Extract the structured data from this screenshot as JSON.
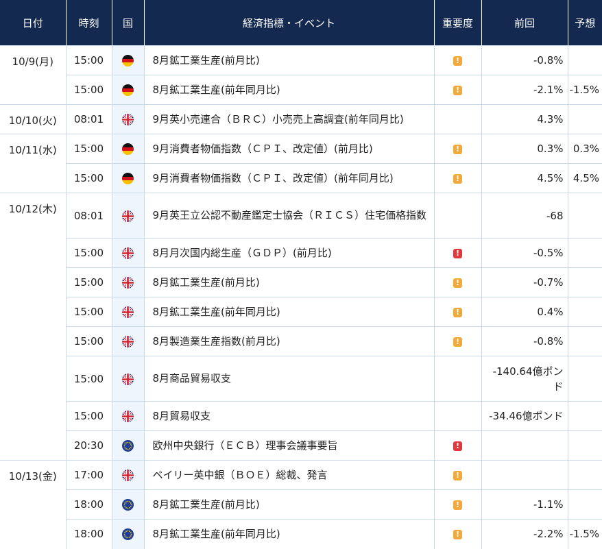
{
  "header": {
    "date": "日付",
    "time": "時刻",
    "country": "国",
    "event": "経済指標・イベント",
    "importance": "重要度",
    "previous": "前回",
    "forecast": "予想"
  },
  "importance_colors": {
    "mid": "#f2a93b",
    "high": "#e0383e"
  },
  "rows": [
    {
      "date": "10/9(月)",
      "time": "15:00",
      "country": "germany-flag-icon",
      "event": "8月鉱工業生産(前月比)",
      "importance": "mid",
      "importance_glyph": "!",
      "previous": "-0.8%",
      "forecast": ""
    },
    {
      "date": "",
      "time": "15:00",
      "country": "germany-flag-icon",
      "event": "8月鉱工業生産(前年同月比)",
      "importance": "mid",
      "importance_glyph": "!",
      "previous": "-2.1%",
      "forecast": "-1.5%"
    },
    {
      "date": "10/10(火)",
      "time": "08:01",
      "country": "uk-flag-icon",
      "event": "9月英小売連合（ＢＲＣ）小売売上高調査(前年同月比)",
      "importance": "",
      "importance_glyph": "",
      "previous": "4.3%",
      "forecast": ""
    },
    {
      "date": "10/11(水)",
      "time": "15:00",
      "country": "germany-flag-icon",
      "event": "9月消費者物価指数（ＣＰＩ、改定値）(前月比)",
      "importance": "mid",
      "importance_glyph": "!",
      "previous": "0.3%",
      "forecast": "0.3%"
    },
    {
      "date": "",
      "time": "15:00",
      "country": "germany-flag-icon",
      "event": "9月消費者物価指数（ＣＰＩ、改定値）(前年同月比)",
      "importance": "mid",
      "importance_glyph": "!",
      "previous": "4.5%",
      "forecast": "4.5%"
    },
    {
      "date": "10/12(木)",
      "time": "08:01",
      "country": "uk-flag-icon",
      "event": "9月英王立公認不動産鑑定士協会（ＲＩＣＳ）住宅価格指数",
      "importance": "",
      "importance_glyph": "",
      "previous": "-68",
      "forecast": ""
    },
    {
      "date": "",
      "time": "15:00",
      "country": "uk-flag-icon",
      "event": "8月月次国内総生産（ＧＤＰ）(前月比)",
      "importance": "high",
      "importance_glyph": "!",
      "previous": "-0.5%",
      "forecast": ""
    },
    {
      "date": "",
      "time": "15:00",
      "country": "uk-flag-icon",
      "event": "8月鉱工業生産(前月比)",
      "importance": "mid",
      "importance_glyph": "!",
      "previous": "-0.7%",
      "forecast": ""
    },
    {
      "date": "",
      "time": "15:00",
      "country": "uk-flag-icon",
      "event": "8月鉱工業生産(前年同月比)",
      "importance": "mid",
      "importance_glyph": "!",
      "previous": "0.4%",
      "forecast": ""
    },
    {
      "date": "",
      "time": "15:00",
      "country": "uk-flag-icon",
      "event": "8月製造業生産指数(前月比)",
      "importance": "mid",
      "importance_glyph": "!",
      "previous": "-0.8%",
      "forecast": ""
    },
    {
      "date": "",
      "time": "15:00",
      "country": "uk-flag-icon",
      "event": "8月商品貿易収支",
      "importance": "",
      "importance_glyph": "",
      "previous": "-140.64億ポンド",
      "forecast": ""
    },
    {
      "date": "",
      "time": "15:00",
      "country": "uk-flag-icon",
      "event": "8月貿易収支",
      "importance": "",
      "importance_glyph": "",
      "previous": "-34.46億ポンド",
      "forecast": ""
    },
    {
      "date": "",
      "time": "20:30",
      "country": "eu-flag-icon",
      "event": "欧州中央銀行（ＥＣＢ）理事会議事要旨",
      "importance": "high",
      "importance_glyph": "!",
      "previous": "",
      "forecast": ""
    },
    {
      "date": "10/13(金)",
      "time": "17:00",
      "country": "uk-flag-icon",
      "event": "ベイリー英中銀（ＢＯＥ）総裁、発言",
      "importance": "mid",
      "importance_glyph": "!",
      "previous": "",
      "forecast": ""
    },
    {
      "date": "",
      "time": "18:00",
      "country": "eu-flag-icon",
      "event": "8月鉱工業生産(前月比)",
      "importance": "mid",
      "importance_glyph": "!",
      "previous": "-1.1%",
      "forecast": ""
    },
    {
      "date": "",
      "time": "18:00",
      "country": "eu-flag-icon",
      "event": "8月鉱工業生産(前年同月比)",
      "importance": "mid",
      "importance_glyph": "!",
      "previous": "-2.2%",
      "forecast": "-1.5%"
    }
  ]
}
